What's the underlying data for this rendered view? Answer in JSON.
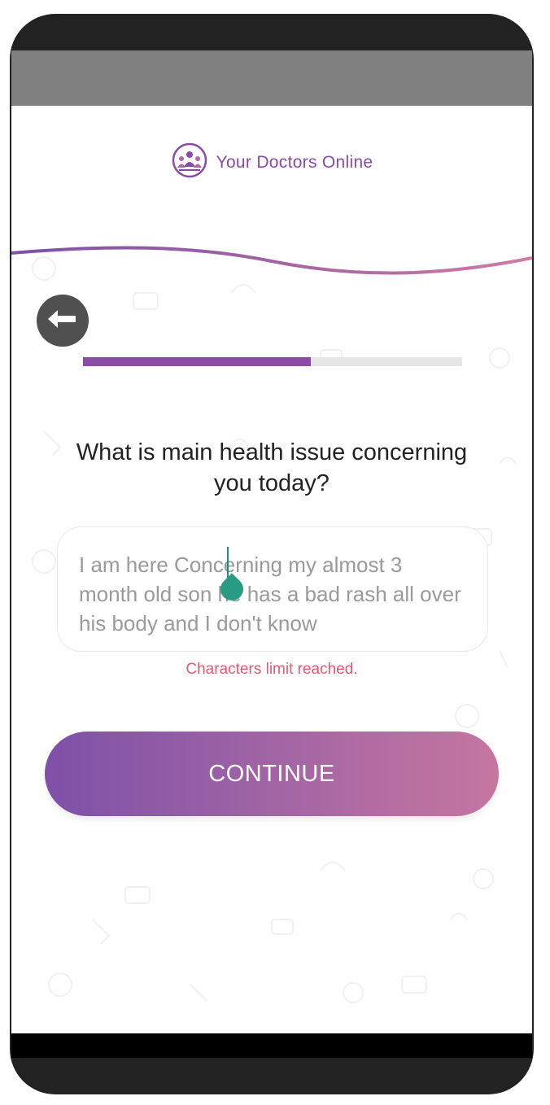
{
  "app": {
    "brand_name": "Your Doctors Online",
    "brand_icon": "doctors-group-icon",
    "brand_color": "#8a4aa6",
    "accent_pink": "#c676a0"
  },
  "navigation": {
    "back_icon": "arrow-left-icon"
  },
  "progress": {
    "fraction": 0.6,
    "fill_color": "#8a4aa6",
    "track_color": "#e6e6e6"
  },
  "form": {
    "question": "What is main health issue concerning you today?",
    "answer_value": "I am here Concerning my almost 3 month old son he has a bad rash all over his body and I don't know",
    "limit_message": "Characters limit reached.",
    "limit_color": "#e05a72"
  },
  "actions": {
    "continue_label": "CONTINUE"
  }
}
